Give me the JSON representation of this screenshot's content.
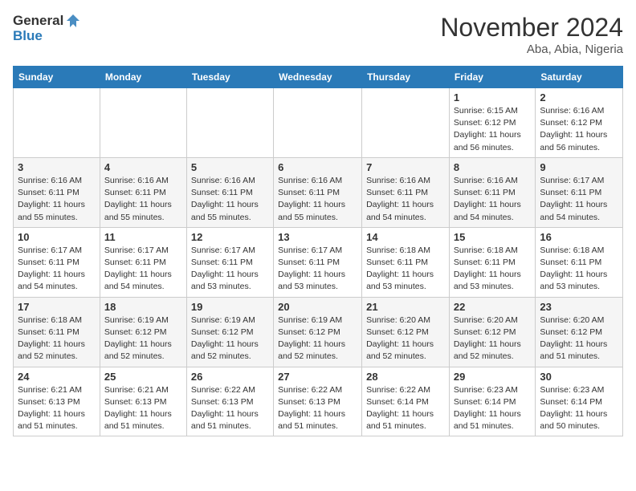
{
  "logo": {
    "line1": "General",
    "line2": "Blue"
  },
  "title": "November 2024",
  "location": "Aba, Abia, Nigeria",
  "weekdays": [
    "Sunday",
    "Monday",
    "Tuesday",
    "Wednesday",
    "Thursday",
    "Friday",
    "Saturday"
  ],
  "weeks": [
    [
      {
        "day": "",
        "info": ""
      },
      {
        "day": "",
        "info": ""
      },
      {
        "day": "",
        "info": ""
      },
      {
        "day": "",
        "info": ""
      },
      {
        "day": "",
        "info": ""
      },
      {
        "day": "1",
        "info": "Sunrise: 6:15 AM\nSunset: 6:12 PM\nDaylight: 11 hours and 56 minutes."
      },
      {
        "day": "2",
        "info": "Sunrise: 6:16 AM\nSunset: 6:12 PM\nDaylight: 11 hours and 56 minutes."
      }
    ],
    [
      {
        "day": "3",
        "info": "Sunrise: 6:16 AM\nSunset: 6:11 PM\nDaylight: 11 hours and 55 minutes."
      },
      {
        "day": "4",
        "info": "Sunrise: 6:16 AM\nSunset: 6:11 PM\nDaylight: 11 hours and 55 minutes."
      },
      {
        "day": "5",
        "info": "Sunrise: 6:16 AM\nSunset: 6:11 PM\nDaylight: 11 hours and 55 minutes."
      },
      {
        "day": "6",
        "info": "Sunrise: 6:16 AM\nSunset: 6:11 PM\nDaylight: 11 hours and 55 minutes."
      },
      {
        "day": "7",
        "info": "Sunrise: 6:16 AM\nSunset: 6:11 PM\nDaylight: 11 hours and 54 minutes."
      },
      {
        "day": "8",
        "info": "Sunrise: 6:16 AM\nSunset: 6:11 PM\nDaylight: 11 hours and 54 minutes."
      },
      {
        "day": "9",
        "info": "Sunrise: 6:17 AM\nSunset: 6:11 PM\nDaylight: 11 hours and 54 minutes."
      }
    ],
    [
      {
        "day": "10",
        "info": "Sunrise: 6:17 AM\nSunset: 6:11 PM\nDaylight: 11 hours and 54 minutes."
      },
      {
        "day": "11",
        "info": "Sunrise: 6:17 AM\nSunset: 6:11 PM\nDaylight: 11 hours and 54 minutes."
      },
      {
        "day": "12",
        "info": "Sunrise: 6:17 AM\nSunset: 6:11 PM\nDaylight: 11 hours and 53 minutes."
      },
      {
        "day": "13",
        "info": "Sunrise: 6:17 AM\nSunset: 6:11 PM\nDaylight: 11 hours and 53 minutes."
      },
      {
        "day": "14",
        "info": "Sunrise: 6:18 AM\nSunset: 6:11 PM\nDaylight: 11 hours and 53 minutes."
      },
      {
        "day": "15",
        "info": "Sunrise: 6:18 AM\nSunset: 6:11 PM\nDaylight: 11 hours and 53 minutes."
      },
      {
        "day": "16",
        "info": "Sunrise: 6:18 AM\nSunset: 6:11 PM\nDaylight: 11 hours and 53 minutes."
      }
    ],
    [
      {
        "day": "17",
        "info": "Sunrise: 6:18 AM\nSunset: 6:11 PM\nDaylight: 11 hours and 52 minutes."
      },
      {
        "day": "18",
        "info": "Sunrise: 6:19 AM\nSunset: 6:12 PM\nDaylight: 11 hours and 52 minutes."
      },
      {
        "day": "19",
        "info": "Sunrise: 6:19 AM\nSunset: 6:12 PM\nDaylight: 11 hours and 52 minutes."
      },
      {
        "day": "20",
        "info": "Sunrise: 6:19 AM\nSunset: 6:12 PM\nDaylight: 11 hours and 52 minutes."
      },
      {
        "day": "21",
        "info": "Sunrise: 6:20 AM\nSunset: 6:12 PM\nDaylight: 11 hours and 52 minutes."
      },
      {
        "day": "22",
        "info": "Sunrise: 6:20 AM\nSunset: 6:12 PM\nDaylight: 11 hours and 52 minutes."
      },
      {
        "day": "23",
        "info": "Sunrise: 6:20 AM\nSunset: 6:12 PM\nDaylight: 11 hours and 51 minutes."
      }
    ],
    [
      {
        "day": "24",
        "info": "Sunrise: 6:21 AM\nSunset: 6:13 PM\nDaylight: 11 hours and 51 minutes."
      },
      {
        "day": "25",
        "info": "Sunrise: 6:21 AM\nSunset: 6:13 PM\nDaylight: 11 hours and 51 minutes."
      },
      {
        "day": "26",
        "info": "Sunrise: 6:22 AM\nSunset: 6:13 PM\nDaylight: 11 hours and 51 minutes."
      },
      {
        "day": "27",
        "info": "Sunrise: 6:22 AM\nSunset: 6:13 PM\nDaylight: 11 hours and 51 minutes."
      },
      {
        "day": "28",
        "info": "Sunrise: 6:22 AM\nSunset: 6:14 PM\nDaylight: 11 hours and 51 minutes."
      },
      {
        "day": "29",
        "info": "Sunrise: 6:23 AM\nSunset: 6:14 PM\nDaylight: 11 hours and 51 minutes."
      },
      {
        "day": "30",
        "info": "Sunrise: 6:23 AM\nSunset: 6:14 PM\nDaylight: 11 hours and 50 minutes."
      }
    ]
  ]
}
